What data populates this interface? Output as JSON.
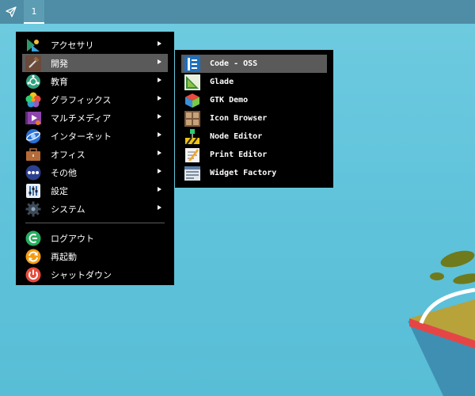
{
  "taskbar": {
    "launcher_icon": "send-icon",
    "workspace_label": "1"
  },
  "main_menu": {
    "items": [
      {
        "label": "アクセサリ",
        "icon": "accessories-icon",
        "submenu": true
      },
      {
        "label": "開発",
        "icon": "development-icon",
        "submenu": true,
        "active": true
      },
      {
        "label": "教育",
        "icon": "education-icon",
        "submenu": true
      },
      {
        "label": "グラフィックス",
        "icon": "graphics-icon",
        "submenu": true
      },
      {
        "label": "マルチメディア",
        "icon": "multimedia-icon",
        "submenu": true
      },
      {
        "label": "インターネット",
        "icon": "internet-icon",
        "submenu": true
      },
      {
        "label": "オフィス",
        "icon": "office-icon",
        "submenu": true
      },
      {
        "label": "その他",
        "icon": "other-icon",
        "submenu": true
      },
      {
        "label": "設定",
        "icon": "settings-icon",
        "submenu": true
      },
      {
        "label": "システム",
        "icon": "system-icon",
        "submenu": true
      }
    ],
    "session_items": [
      {
        "label": "ログアウト",
        "icon": "logout-icon"
      },
      {
        "label": "再起動",
        "icon": "reboot-icon"
      },
      {
        "label": "シャットダウン",
        "icon": "shutdown-icon"
      }
    ]
  },
  "sub_menu": {
    "items": [
      {
        "label": "Code - OSS",
        "icon": "code-oss-icon",
        "active": true
      },
      {
        "label": "Glade",
        "icon": "glade-icon"
      },
      {
        "label": "GTK Demo",
        "icon": "gtk-demo-icon"
      },
      {
        "label": "Icon Browser",
        "icon": "icon-browser-icon"
      },
      {
        "label": "Node Editor",
        "icon": "node-editor-icon"
      },
      {
        "label": "Print Editor",
        "icon": "print-editor-icon"
      },
      {
        "label": "Widget Factory",
        "icon": "widget-factory-icon"
      }
    ]
  },
  "colors": {
    "desktop": "#5ec2da",
    "taskbar": "#4e8da5",
    "menu_bg": "#000000",
    "highlight": "#5a5a5a"
  }
}
